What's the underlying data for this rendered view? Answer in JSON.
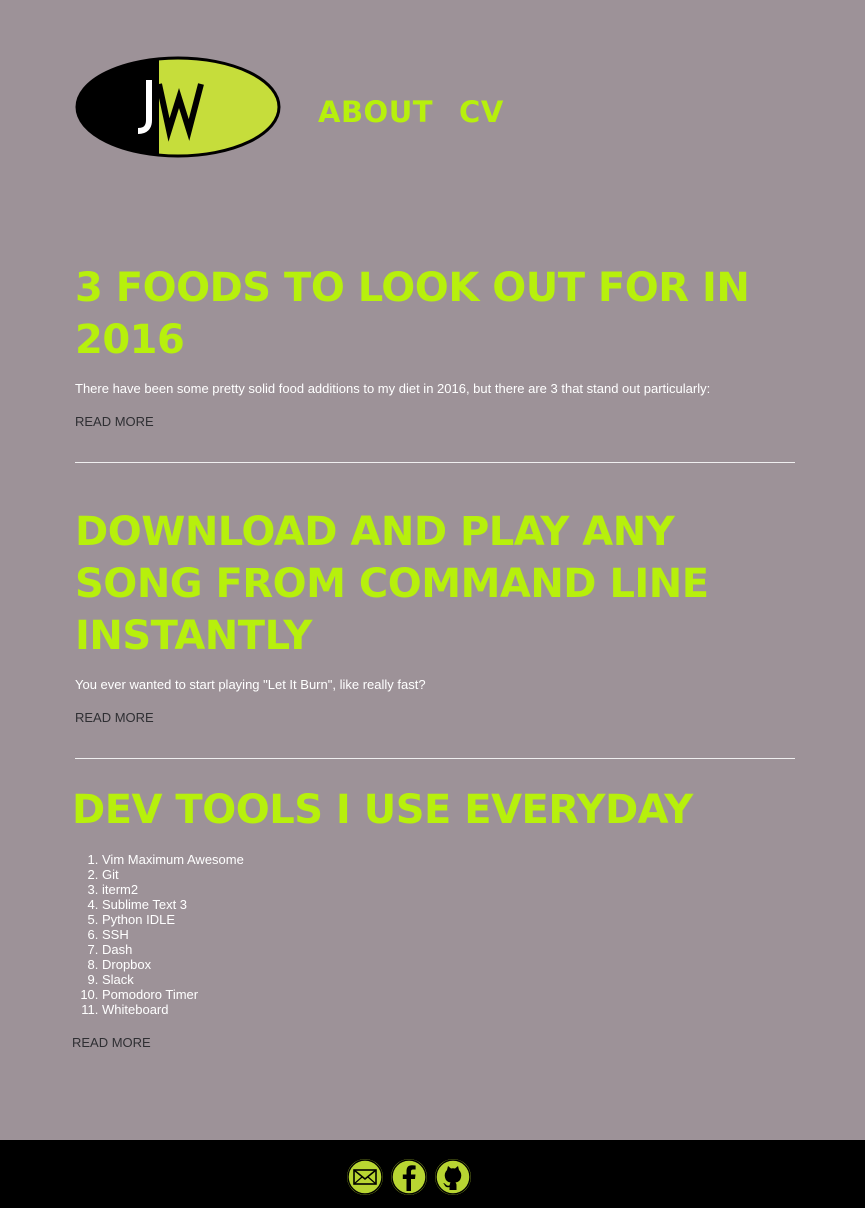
{
  "header": {
    "logo_text": "JW",
    "nav": [
      {
        "label": "ABOUT"
      },
      {
        "label": "CV"
      }
    ]
  },
  "posts": [
    {
      "title": "3 FOODS TO LOOK OUT FOR IN 2016",
      "excerpt": "There have been some pretty solid food additions to my diet in 2016, but there are 3 that stand out particularly:",
      "read_more": "READ MORE"
    },
    {
      "title": "DOWNLOAD AND PLAY ANY SONG FROM COMMAND LINE INSTANTLY",
      "excerpt": "You ever wanted to start playing \"Let It Burn\", like really fast?",
      "read_more": "READ MORE"
    },
    {
      "title": "DEV TOOLS I USE EVERYDAY",
      "items": [
        "Vim Maximum Awesome",
        "Git",
        "iterm2",
        "Sublime Text 3",
        "Python IDLE",
        "SSH",
        "Dash",
        "Dropbox",
        "Slack",
        "Pomodoro Timer",
        "Whiteboard"
      ],
      "read_more": "READ MORE"
    }
  ],
  "footer": {
    "social": [
      {
        "icon": "mail-icon"
      },
      {
        "icon": "facebook-icon"
      },
      {
        "icon": "github-icon"
      }
    ]
  },
  "colors": {
    "background": "#9d9298",
    "accent": "#b7f00c",
    "footer": "#000000",
    "social_button": "#b8d532"
  }
}
